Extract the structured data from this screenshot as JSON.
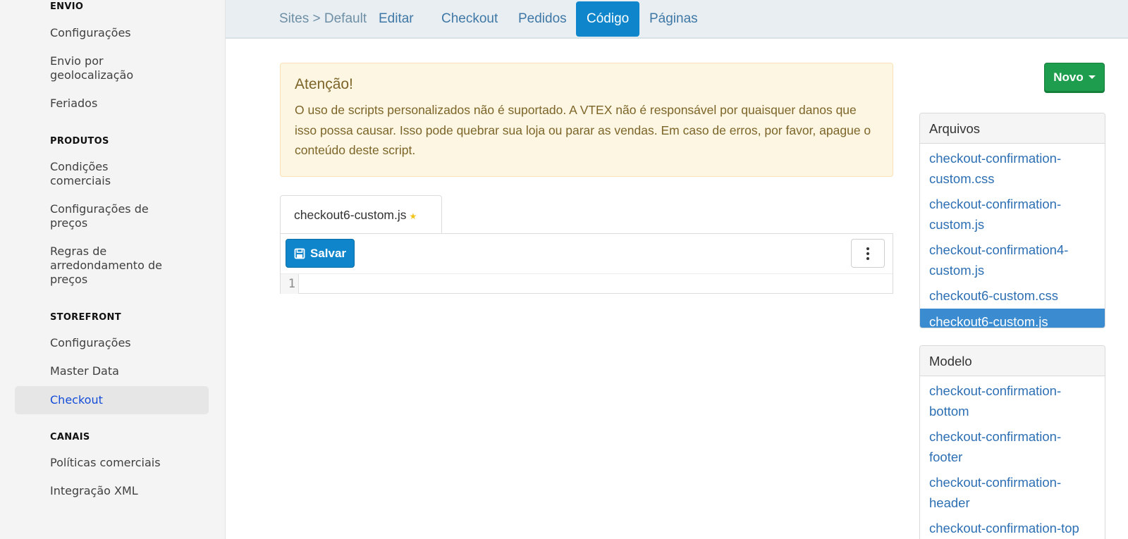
{
  "sidebar": {
    "sections": [
      {
        "heading": "ENVIO",
        "items": [
          {
            "label": "Configurações"
          },
          {
            "label": "Envio por\ngeolocalização"
          },
          {
            "label": "Feriados"
          }
        ]
      },
      {
        "heading": "PRODUTOS",
        "items": [
          {
            "label": "Condições\ncomerciais"
          },
          {
            "label": "Configurações de\npreços"
          },
          {
            "label": "Regras de\narredondamento de\npreços"
          }
        ]
      },
      {
        "heading": "STOREFRONT",
        "items": [
          {
            "label": "Configurações"
          },
          {
            "label": "Master Data"
          },
          {
            "label": "Checkout"
          }
        ]
      },
      {
        "heading": "CANAIS",
        "items": [
          {
            "label": "Políticas comerciais"
          },
          {
            "label": "Integração XML"
          }
        ]
      }
    ],
    "active_item": "Checkout"
  },
  "topnav": {
    "breadcrumb": "Sites > Default",
    "tabs": [
      {
        "label": "Editar"
      },
      {
        "label": "Checkout"
      },
      {
        "label": "Pedidos"
      },
      {
        "label": "Código"
      },
      {
        "label": "Páginas"
      }
    ],
    "active_tab": "Código"
  },
  "warning": {
    "title": "Atenção!",
    "text": "O uso de scripts personalizados não é suportado. A VTEX não é responsável por quaisquer danos que isso possa causar. Isso pode quebrar sua loja ou parar as vendas. Em caso de erros, por favor, apague o conteúdo deste script."
  },
  "editor": {
    "file_name": "checkout6-custom.js",
    "modified_marker": "★",
    "save_label": "Salvar",
    "line_number": "1",
    "save_icon": "floppy-disk-icon",
    "more_icon": "vertical-ellipsis-icon"
  },
  "right_panel": {
    "new_button_label": "Novo",
    "files": {
      "heading": "Arquivos",
      "items": [
        {
          "label": "checkout-confirmation-\ncustom.css"
        },
        {
          "label": "checkout-confirmation-\ncustom.js"
        },
        {
          "label": "checkout-confirmation4-\ncustom.js"
        },
        {
          "label": "checkout6-custom.css"
        },
        {
          "label": "checkout6-custom.js"
        }
      ],
      "active_item": "checkout6-custom.js"
    },
    "templates": {
      "heading": "Modelo",
      "items": [
        {
          "label": "checkout-confirmation-\nbottom"
        },
        {
          "label": "checkout-confirmation-\nfooter"
        },
        {
          "label": "checkout-confirmation-\nheader"
        },
        {
          "label": "checkout-confirmation-top"
        }
      ]
    }
  },
  "colors": {
    "primary_blue": "#0f86cc",
    "green_button": "#1f9d4f",
    "active_list_item": "#3b8bd1",
    "warning_bg": "#fcf6e2",
    "link_blue": "#2d6fb3"
  }
}
